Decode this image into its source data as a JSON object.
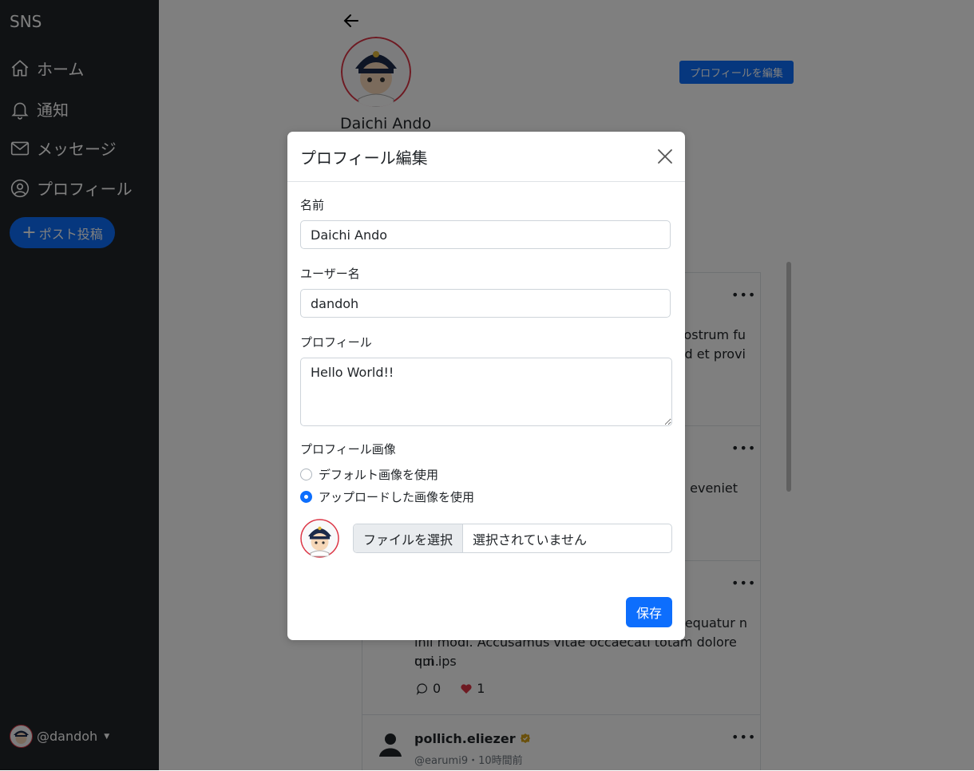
{
  "sidebar": {
    "brand": "SNS",
    "items": [
      {
        "label": "ホーム",
        "icon": "home-icon"
      },
      {
        "label": "通知",
        "icon": "bell-icon"
      },
      {
        "label": "メッセージ",
        "icon": "envelope-icon"
      },
      {
        "label": "プロフィール",
        "icon": "person-circle-icon"
      }
    ],
    "post_button": "ポスト投稿",
    "user_handle": "@dandoh"
  },
  "profile": {
    "name": "Daichi Ando",
    "edit_button": "プロフィールを編集"
  },
  "feed": {
    "posts": [
      {
        "body_line1": "nostrum fu",
        "body_line2": "uid et provi"
      },
      {
        "body_line1": "m eveniet"
      },
      {
        "body_line1": "sequatur n",
        "body_line2": "ihil modi. Accusamus vitae occaecati totam dolore qui ips",
        "body_line3": "um.",
        "comments": "0",
        "likes": "1"
      },
      {
        "author": "pollich.eliezer",
        "handle_time": "@earumi9・10時間前"
      }
    ]
  },
  "modal": {
    "title": "プロフィール編集",
    "name_label": "名前",
    "name_value": "Daichi Ando",
    "username_label": "ユーザー名",
    "username_value": "dandoh",
    "bio_label": "プロフィール",
    "bio_value": "Hello World!!",
    "image_label": "プロフィール画像",
    "radio_default": "デフォルト画像を使用",
    "radio_uploaded": "アップロードした画像を使用",
    "file_button": "ファイルを選択",
    "file_status": "選択されていません",
    "save_button": "保存"
  },
  "colors": {
    "sidebar_bg": "#212529",
    "primary": "#0d6efd",
    "like_heart": "#dc3545",
    "verified_badge": "#d4a017"
  }
}
